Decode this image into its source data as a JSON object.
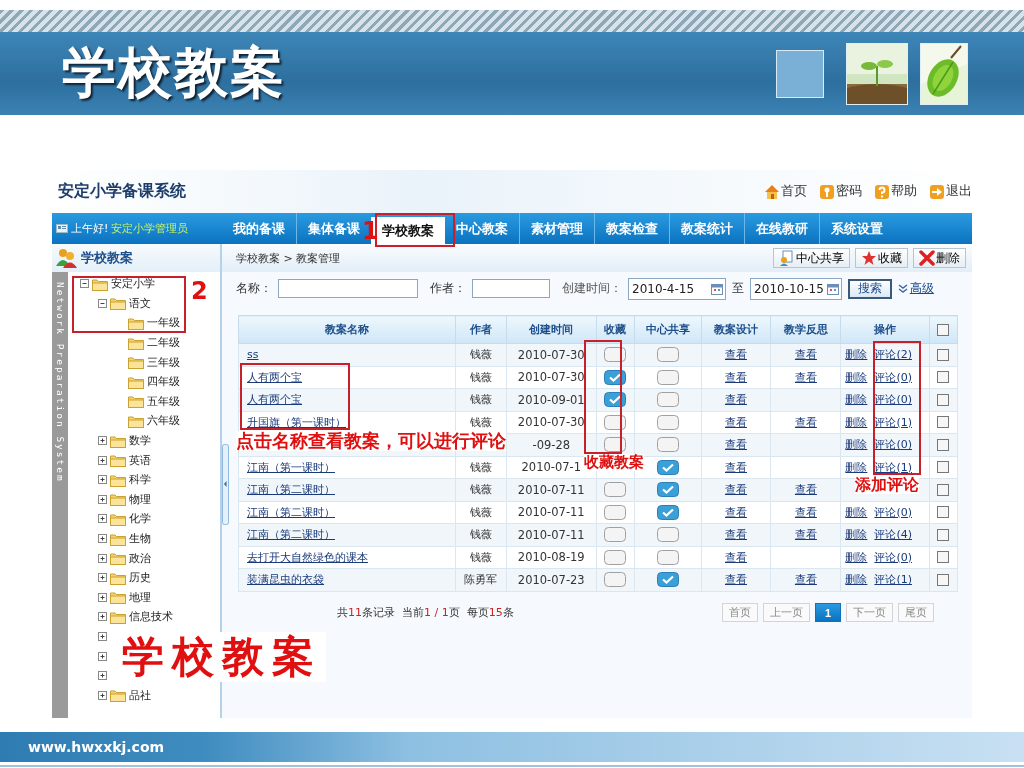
{
  "slide": {
    "title": "学校教案",
    "footer": "www.hwxxkj.com"
  },
  "app": {
    "title": "安定小学备课系统",
    "top_links": [
      {
        "kind": "home",
        "label": "首页"
      },
      {
        "kind": "password",
        "label": "密码"
      },
      {
        "kind": "help",
        "label": "帮助"
      },
      {
        "kind": "logout",
        "label": "退出"
      }
    ],
    "greeting": "上午好!",
    "user": "安定小学管理员",
    "nav": [
      {
        "label": "我的备课",
        "selected": false
      },
      {
        "label": "集体备课",
        "selected": false
      },
      {
        "label": "学校教案",
        "selected": true
      },
      {
        "label": "中心教案",
        "selected": false
      },
      {
        "label": "素材管理",
        "selected": false
      },
      {
        "label": "教案检查",
        "selected": false
      },
      {
        "label": "教案统计",
        "selected": false
      },
      {
        "label": "在线教研",
        "selected": false
      },
      {
        "label": "系统设置",
        "selected": false
      }
    ]
  },
  "sidebar": {
    "title": "学校教案",
    "watermark": "Network Preparation System",
    "tree": [
      {
        "label": "安定小学",
        "expanded": true,
        "children": [
          {
            "label": "语文",
            "expanded": true,
            "children": [
              {
                "label": "一年级"
              },
              {
                "label": "二年级"
              },
              {
                "label": "三年级"
              },
              {
                "label": "四年级"
              },
              {
                "label": "五年级"
              },
              {
                "label": "六年级"
              }
            ]
          },
          {
            "label": "数学",
            "expanded": false
          },
          {
            "label": "英语",
            "expanded": false
          },
          {
            "label": "科学",
            "expanded": false
          },
          {
            "label": "物理",
            "expanded": false
          },
          {
            "label": "化学",
            "expanded": false
          },
          {
            "label": "生物",
            "expanded": false
          },
          {
            "label": "政治",
            "expanded": false
          },
          {
            "label": "历史",
            "expanded": false
          },
          {
            "label": "地理",
            "expanded": false
          },
          {
            "label": "信息技术",
            "expanded": false
          },
          {
            "expanded": false
          },
          {
            "expanded": false
          },
          {
            "expanded": false
          },
          {
            "label": "品社",
            "expanded": false
          }
        ]
      }
    ]
  },
  "breadcrumb": "学校教案 > 教案管理",
  "toolbar": [
    {
      "kind": "share",
      "label": "中心共享"
    },
    {
      "kind": "favorite",
      "label": "收藏"
    },
    {
      "kind": "delete",
      "label": "删除"
    }
  ],
  "search": {
    "name_label": "名称：",
    "author_label": "作者：",
    "date_label": "创建时间：",
    "date_from": "2010-4-15",
    "to_label": "至",
    "date_to": "2010-10-15",
    "button": "搜索",
    "advanced": "高级"
  },
  "table": {
    "columns": [
      "教案名称",
      "作者",
      "创建时间",
      "收藏",
      "中心共享",
      "教案设计",
      "教学反思",
      "操作"
    ],
    "select_all": {
      "checked": false
    },
    "rows": [
      {
        "name": "ss",
        "author": "钱薇",
        "created": "2010-07-30",
        "collected": false,
        "shared": false,
        "design": "查看",
        "reflection": "查看",
        "delete": "删除",
        "comment": "评论(2)",
        "checked": false
      },
      {
        "name": "人有两个宝",
        "author": "钱薇",
        "created": "2010-07-30",
        "collected": true,
        "shared": false,
        "design": "查看",
        "reflection": "查看",
        "delete": "删除",
        "comment": "评论(0)",
        "checked": false
      },
      {
        "name": "人有两个宝",
        "author": "钱薇",
        "created": "2010-09-01",
        "collected": true,
        "shared": false,
        "design": "查看",
        "delete": "删除",
        "comment": "评论(0)",
        "checked": false
      },
      {
        "name": "升国旗（第一课时）",
        "author": "钱薇",
        "created": "2010-07-30",
        "collected": false,
        "shared": false,
        "design": "查看",
        "reflection": "查看",
        "delete": "删除",
        "comment": "评论(1)",
        "checked": false
      },
      {
        "created": "-09-28",
        "collected": false,
        "shared": false,
        "design": "查看",
        "delete": "删除",
        "comment": "评论(0)",
        "checked": false
      },
      {
        "name": "江南（第一课时）",
        "author": "钱薇",
        "created": "2010-07-1",
        "shared": true,
        "design": "查看",
        "delete": "删除",
        "comment": "评论(1)",
        "checked": false
      },
      {
        "name": "江南（第二课时）",
        "author": "钱薇",
        "created": "2010-07-11",
        "collected": false,
        "shared": true,
        "design": "查看",
        "reflection": "查看",
        "checked": false
      },
      {
        "name": "江南（第二课时）",
        "author": "钱薇",
        "created": "2010-07-11",
        "collected": false,
        "shared": true,
        "design": "查看",
        "reflection": "查看",
        "delete": "删除",
        "comment": "评论(0)",
        "checked": false
      },
      {
        "name": "江南（第二课时）",
        "author": "钱薇",
        "created": "2010-07-11",
        "collected": false,
        "shared": false,
        "design": "查看",
        "reflection": "查看",
        "delete": "删除",
        "comment": "评论(4)",
        "checked": false
      },
      {
        "name": "去打开大自然绿色的课本",
        "author": "钱薇",
        "created": "2010-08-19",
        "collected": false,
        "shared": false,
        "design": "查看",
        "delete": "删除",
        "comment": "评论(0)",
        "checked": false
      },
      {
        "name": "装满昆虫的衣袋",
        "author": "陈勇军",
        "created": "2010-07-23",
        "collected": false,
        "shared": true,
        "design": "查看",
        "reflection": "查看",
        "delete": "删除",
        "comment": "评论(1)",
        "checked": false
      }
    ]
  },
  "summary": [
    {
      "text": "共",
      "highlight": false
    },
    {
      "text": "11",
      "highlight": true
    },
    {
      "text": "条记录  当前",
      "highlight": false
    },
    {
      "text": "1 / 1",
      "highlight": true
    },
    {
      "text": "页  每页",
      "highlight": false
    },
    {
      "text": "15",
      "highlight": true
    },
    {
      "text": "条",
      "highlight": false
    }
  ],
  "pager": [
    {
      "label": "首页",
      "selected": false
    },
    {
      "label": "上一页",
      "selected": false
    },
    {
      "label": "1",
      "selected": true
    },
    {
      "label": "下一页",
      "selected": false
    },
    {
      "label": "尾页",
      "selected": false
    }
  ],
  "annotations": [
    {
      "kind": "number",
      "text": "1"
    },
    {
      "kind": "number",
      "text": "2"
    },
    {
      "kind": "note",
      "text": "点击名称查看教案，可以进行评论"
    },
    {
      "kind": "note",
      "text": "收藏教案"
    },
    {
      "kind": "note",
      "text": "添加评论"
    },
    {
      "kind": "headline",
      "text": "学校教案"
    }
  ]
}
